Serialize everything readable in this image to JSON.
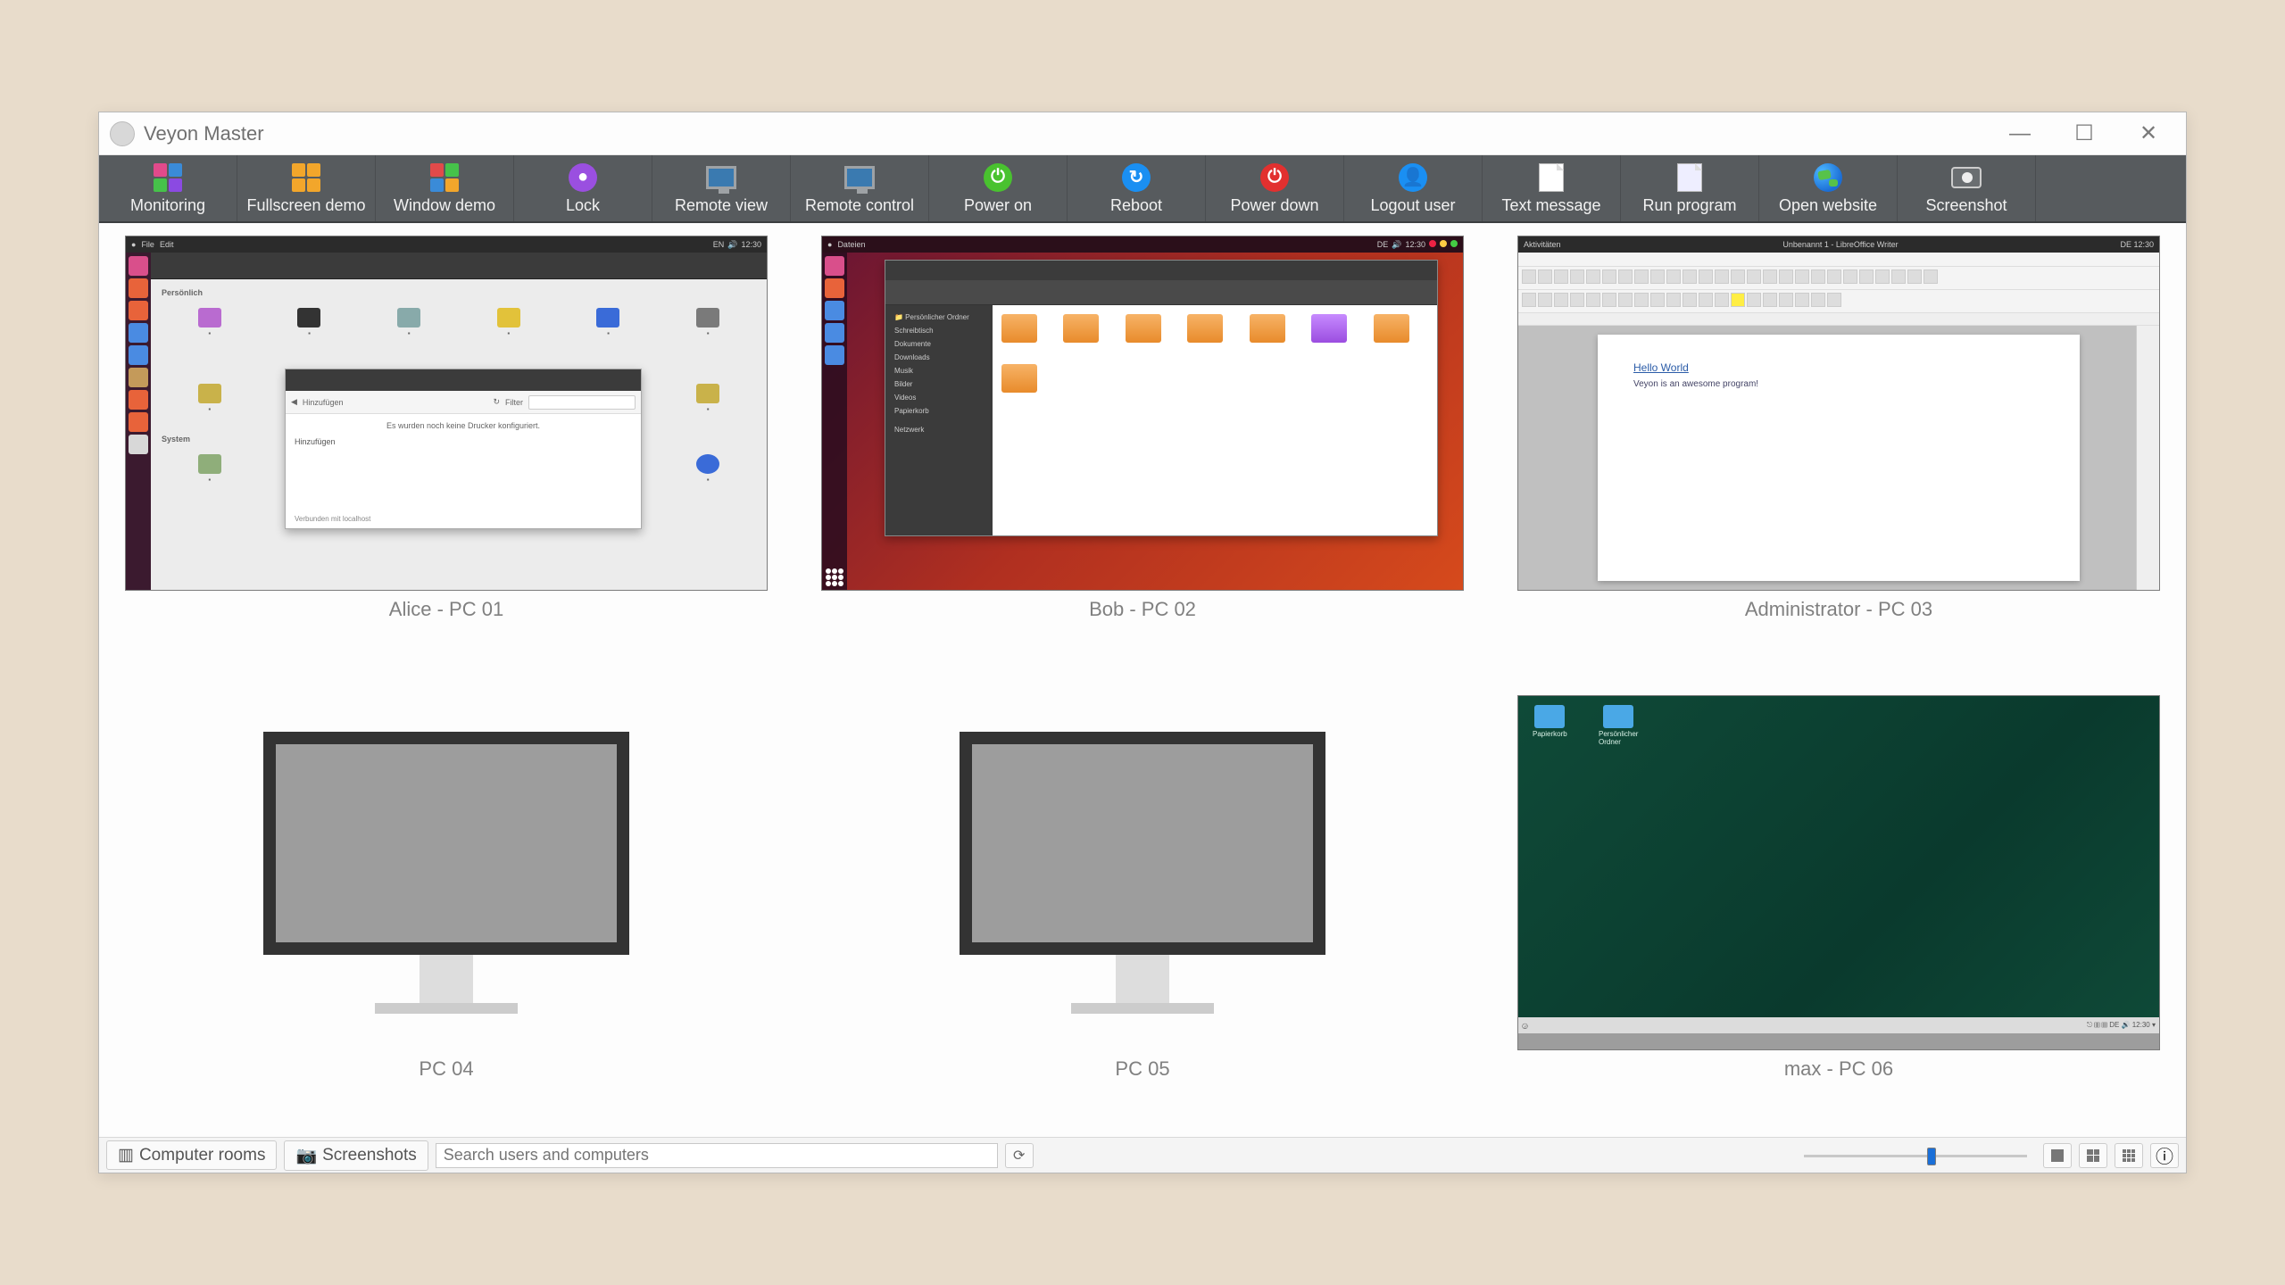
{
  "window": {
    "title": "Veyon Master"
  },
  "toolbar": [
    {
      "label": "Monitoring",
      "icon": "monitoring"
    },
    {
      "label": "Fullscreen demo",
      "icon": "fullscreen-demo"
    },
    {
      "label": "Window demo",
      "icon": "window-demo"
    },
    {
      "label": "Lock",
      "icon": "lock"
    },
    {
      "label": "Remote view",
      "icon": "remote-view"
    },
    {
      "label": "Remote control",
      "icon": "remote-control"
    },
    {
      "label": "Power on",
      "icon": "power-on"
    },
    {
      "label": "Reboot",
      "icon": "reboot"
    },
    {
      "label": "Power down",
      "icon": "power-down"
    },
    {
      "label": "Logout user",
      "icon": "logout-user"
    },
    {
      "label": "Text message",
      "icon": "text-message"
    },
    {
      "label": "Run program",
      "icon": "run-program"
    },
    {
      "label": "Open website",
      "icon": "open-website"
    },
    {
      "label": "Screenshot",
      "icon": "screenshot"
    }
  ],
  "computers": [
    {
      "caption": "Alice - PC 01"
    },
    {
      "caption": "Bob - PC 02"
    },
    {
      "caption": "Administrator - PC 03"
    },
    {
      "caption": "PC 04"
    },
    {
      "caption": "PC 05"
    },
    {
      "caption": "max - PC 06"
    }
  ],
  "statusbar": {
    "computer_rooms": "Computer rooms",
    "screenshots": "Screenshots",
    "search_placeholder": "Search users and computers"
  },
  "colors": {
    "power_on": "#49c22f",
    "reboot": "#1a8ff2",
    "power_down": "#e2302f",
    "logout": "#1a8ff2",
    "lock": "#9a4fe0"
  }
}
